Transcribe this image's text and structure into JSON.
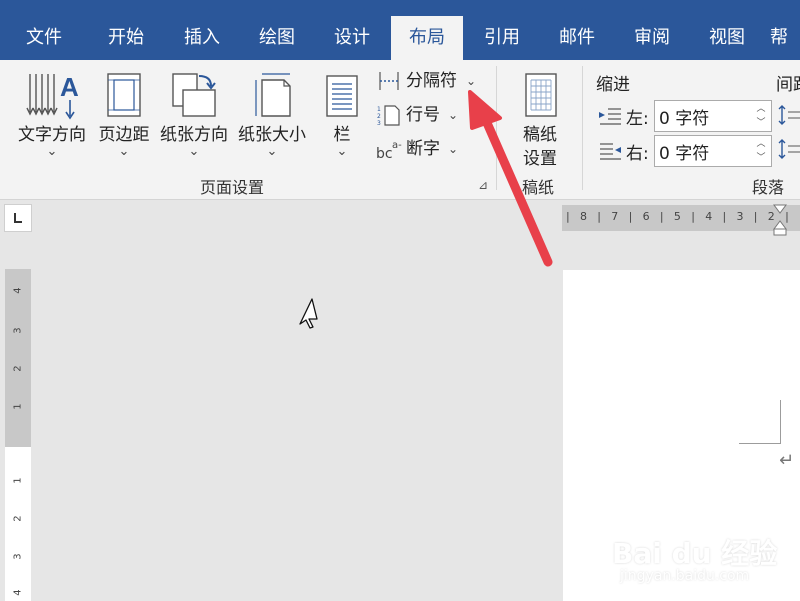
{
  "tabs": [
    {
      "label": "文件",
      "active": false
    },
    {
      "label": "开始",
      "active": false
    },
    {
      "label": "插入",
      "active": false
    },
    {
      "label": "绘图",
      "active": false
    },
    {
      "label": "设计",
      "active": false
    },
    {
      "label": "布局",
      "active": true
    },
    {
      "label": "引用",
      "active": false
    },
    {
      "label": "邮件",
      "active": false
    },
    {
      "label": "审阅",
      "active": false
    },
    {
      "label": "视图",
      "active": false
    },
    {
      "label": "帮",
      "active": false
    }
  ],
  "page_setup": {
    "text_direction": "文字方向",
    "margins": "页边距",
    "orientation": "纸张方向",
    "size": "纸张大小",
    "columns": "栏",
    "breaks": "分隔符",
    "line_numbers": "行号",
    "hyphenation": "断字",
    "group_label": "页面设置"
  },
  "manuscript": {
    "button_line1": "稿纸",
    "button_line2": "设置",
    "group_label": "稿纸"
  },
  "paragraph": {
    "indent_title": "缩进",
    "spacing_title": "间距",
    "left_label": "左:",
    "left_value": "0 字符",
    "right_label": "右:",
    "right_value": "0 字符",
    "group_label": "段落"
  },
  "ruler": {
    "horizontal": "| 8 | 7 | 6 | 5 | 4 | 3 | 2 | 1 |",
    "vertical_marks": [
      "4",
      "3",
      "2",
      "1",
      "1",
      "2",
      "3",
      "4"
    ]
  },
  "document": {
    "paragraph_mark": "↵"
  },
  "watermark": {
    "brand": "Bai du 经验",
    "url": "jingyan.baidu.com"
  },
  "colors": {
    "tab_bar": "#2b579a",
    "ribbon": "#f3f3f3",
    "arrow": "#e8404a",
    "workspace": "#e6e6e6"
  }
}
